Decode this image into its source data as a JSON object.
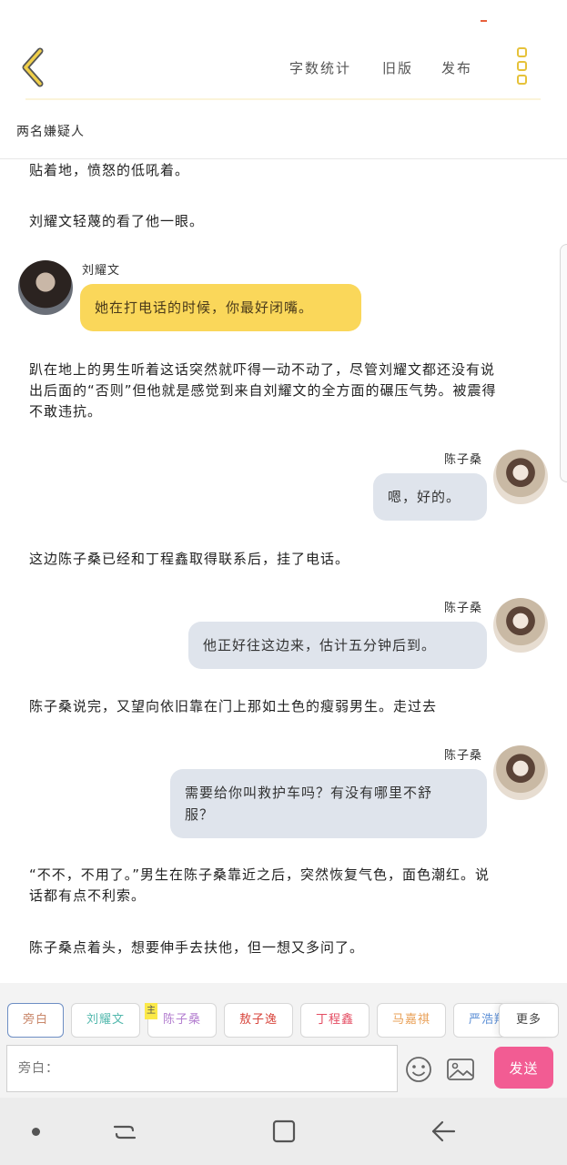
{
  "header": {
    "actions": [
      "字数统计",
      "旧版",
      "发布"
    ]
  },
  "chapter": {
    "title": "两名嫌疑人"
  },
  "messages": [
    {
      "type": "narration",
      "text": "贴着地，愤怒的低吼着。"
    },
    {
      "type": "narration",
      "text": "刘耀文轻蔑的看了他一眼。"
    },
    {
      "type": "dialogue",
      "side": "left",
      "speaker": "刘耀文",
      "text": "她在打电话的时候，你最好闭嘴。"
    },
    {
      "type": "narration",
      "text": "趴在地上的男生听着这话突然就吓得一动不动了，尽管刘耀文都还没有说出后面的“否则”但他就是感觉到来自刘耀文的全方面的碾压气势。被震得不敢违抗。"
    },
    {
      "type": "dialogue",
      "side": "right",
      "speaker": "陈子桑",
      "text": "嗯，好的。"
    },
    {
      "type": "narration",
      "text": "这边陈子桑已经和丁程鑫取得联系后，挂了电话。"
    },
    {
      "type": "dialogue",
      "side": "right",
      "speaker": "陈子桑",
      "text": "他正好往这边来，估计五分钟后到。"
    },
    {
      "type": "narration",
      "text": "陈子桑说完，又望向依旧靠在门上那如土色的瘦弱男生。走过去"
    },
    {
      "type": "dialogue",
      "side": "right",
      "speaker": "陈子桑",
      "text": "需要给你叫救护车吗？有没有哪里不舒服？"
    },
    {
      "type": "narration",
      "text": "“不不，不用了。”男生在陈子桑靠近之后，突然恢复气色，面色潮红。说话都有点不利索。"
    },
    {
      "type": "narration",
      "text": "陈子桑点着头，想要伸手去扶他，但一想又多问了。"
    }
  ],
  "roles": [
    {
      "label": "旁白",
      "color": "#c9876a"
    },
    {
      "label": "刘耀文",
      "color": "#52b8ad"
    },
    {
      "label": "陈子桑",
      "color": "#b47fd0"
    },
    {
      "label": "敖子逸",
      "color": "#d8463d"
    },
    {
      "label": "丁程鑫",
      "color": "#e44c62"
    },
    {
      "label": "马嘉祺",
      "color": "#e9a057"
    },
    {
      "label": "严浩翔",
      "color": "#5c8fd6"
    }
  ],
  "main_tag": "主",
  "more_label": "更多",
  "input": {
    "placeholder": "旁白："
  },
  "send_label": "发送",
  "colors": {
    "accent_yellow": "#e6c23a",
    "bubble_left": "#fad75a",
    "bubble_right": "#dfe4ec",
    "send_button": "#f25c93"
  },
  "icons": [
    "back-chevron-icon",
    "more-vertical-icon",
    "emoji-icon",
    "image-icon",
    "nav-recent-icon",
    "nav-home-icon",
    "nav-back-icon"
  ]
}
